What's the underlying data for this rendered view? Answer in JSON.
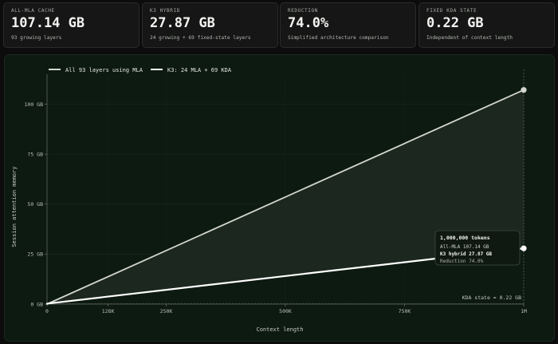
{
  "cards": [
    {
      "label": "ALL-MLA CACHE",
      "value": "107.14 GB",
      "sub": "93 growing layers"
    },
    {
      "label": "K3 HYBRID",
      "value": "27.87 GB",
      "sub": "24 growing + 69 fixed-state layers"
    },
    {
      "label": "REDUCTION",
      "value": "74.0%",
      "sub": "Simplified architecture comparison"
    },
    {
      "label": "FIXED KDA STATE",
      "value": "0.22 GB",
      "sub": "Independent of context length"
    }
  ],
  "colors": {
    "page_bg": "#0b0c0b",
    "panel_bg": "#0d1a12",
    "all_mla_line": "#d3d6ce",
    "k3_line": "#ffffff",
    "fill_between": "#1f2a22"
  },
  "chart_data": {
    "type": "line",
    "xlabel": "Context length",
    "ylabel": "Session attention memory",
    "xlim": [
      0,
      1000000
    ],
    "ylim": [
      0,
      115
    ],
    "xticks": [
      {
        "value": 0,
        "label": "0"
      },
      {
        "value": 128000,
        "label": "128K"
      },
      {
        "value": 250000,
        "label": "250K"
      },
      {
        "value": 500000,
        "label": "500K"
      },
      {
        "value": 750000,
        "label": "750K"
      },
      {
        "value": 1000000,
        "label": "1M"
      }
    ],
    "yticks": [
      {
        "value": 0,
        "label": "0 GB"
      },
      {
        "value": 25,
        "label": "25 GB"
      },
      {
        "value": 50,
        "label": "50 GB"
      },
      {
        "value": 75,
        "label": "75 GB"
      },
      {
        "value": 100,
        "label": "100 GB"
      }
    ],
    "grid": true,
    "legend_position": "top-left",
    "series": [
      {
        "name": "All 93 layers using MLA",
        "color": "#d3d6ce",
        "x": [
          0,
          1000000
        ],
        "y": [
          0,
          107.14
        ]
      },
      {
        "name": "K3: 24 MLA + 69 KDA",
        "color": "#ffffff",
        "x": [
          0,
          1000000
        ],
        "y": [
          0.22,
          27.87
        ]
      }
    ],
    "kda_state": {
      "value": 0.22,
      "label": "KDA state ≈ 0.22 GB"
    },
    "tooltip": {
      "title": "1,000,000 tokens",
      "line1": "All-MLA 107.14 GB",
      "line2": "K3 hybrid 27.87 GB",
      "line3": "Reduction 74.0%"
    }
  }
}
